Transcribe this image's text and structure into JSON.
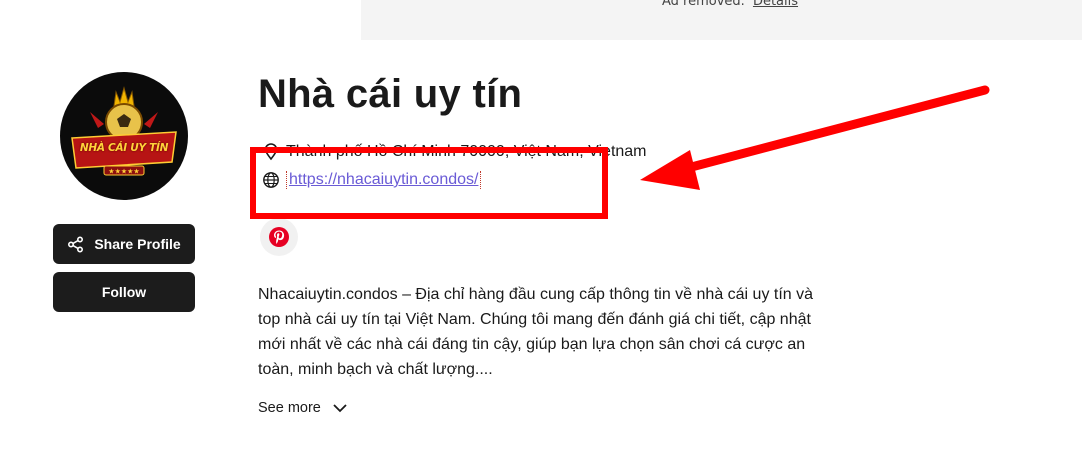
{
  "ad": {
    "text": "Ad removed.",
    "link": "Details"
  },
  "profile": {
    "name": "Nhà cái uy tín",
    "logo_text": "NHÀ CÁI UY TÍN",
    "location": "Thành phố Hồ Chí Minh 70000, Việt Nam, Vietnam",
    "website": "https://nhacaiuytin.condos/",
    "bio": "Nhacaiuytin.condos – Địa chỉ hàng đầu cung cấp thông tin về nhà cái uy tín và top nhà cái uy tín tại Việt Nam. Chúng tôi mang đến đánh giá chi tiết, cập nhật mới nhất về các nhà cái đáng tin cậy, giúp bạn lựa chọn sân chơi cá cược an toàn, minh bạch và chất lượng...."
  },
  "actions": {
    "share_label": "Share Profile",
    "follow_label": "Follow",
    "see_more_label": "See more"
  },
  "social": {
    "pinterest_icon": "pinterest-icon",
    "pinterest_color": "#e60023"
  },
  "colors": {
    "annotation": "#ff0000",
    "link": "#6a5bd6",
    "button_bg": "#1c1c1c"
  }
}
